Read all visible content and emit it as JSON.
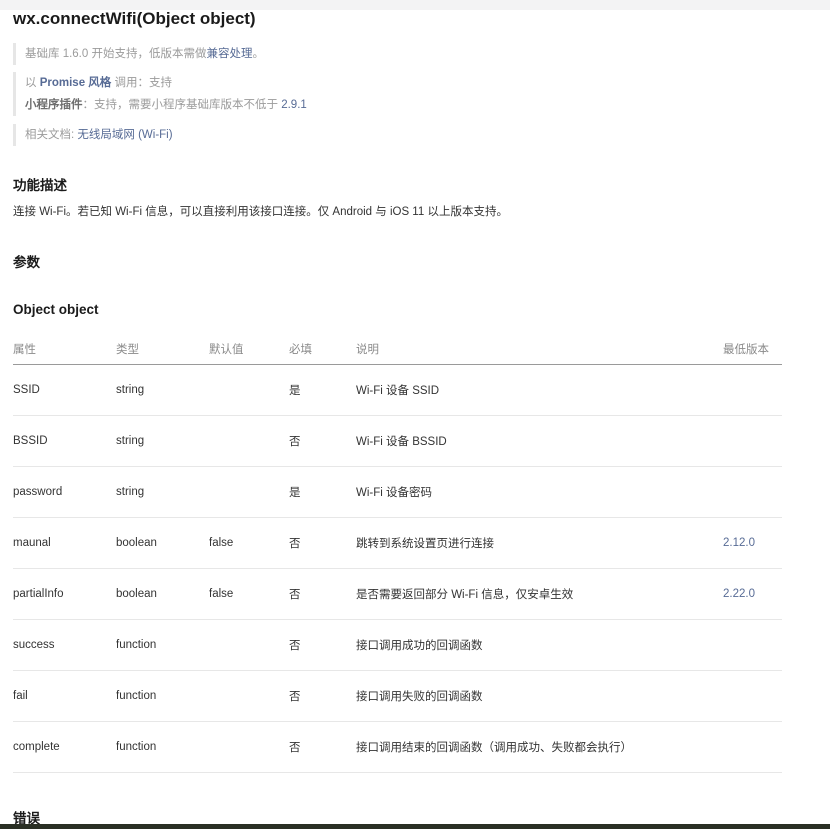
{
  "title": "wx.connectWifi(Object object)",
  "support": {
    "base_text_1": "基础库 1.6.0 开始支持，低版本需做",
    "base_link": "兼容处理",
    "base_text_2": "。",
    "promise_prefix": "以 ",
    "promise_link": "Promise 风格",
    "promise_suffix": " 调用：支持",
    "plugin_label": "小程序插件",
    "plugin_text": "：支持，需要小程序基础库版本不低于 ",
    "plugin_version": "2.9.1",
    "doc_label": "相关文档: ",
    "doc_link": "无线局域网 (Wi-Fi)"
  },
  "sections": {
    "feature": "功能描述",
    "feature_desc": "连接 Wi-Fi。若已知 Wi-Fi 信息，可以直接利用该接口连接。仅 Android 与 iOS 11 以上版本支持。",
    "params": "参数",
    "object": "Object object",
    "errors": "错误"
  },
  "table": {
    "headers": [
      "属性",
      "类型",
      "默认值",
      "必填",
      "说明",
      "最低版本"
    ],
    "rows": [
      {
        "name": "SSID",
        "type": "string",
        "default": "",
        "required": "是",
        "desc": "Wi-Fi 设备 SSID",
        "version": ""
      },
      {
        "name": "BSSID",
        "type": "string",
        "default": "",
        "required": "否",
        "desc": "Wi-Fi 设备 BSSID",
        "version": ""
      },
      {
        "name": "password",
        "type": "string",
        "default": "",
        "required": "是",
        "desc": "Wi-Fi 设备密码",
        "version": ""
      },
      {
        "name": "maunal",
        "type": "boolean",
        "default": "false",
        "required": "否",
        "desc": "跳转到系统设置页进行连接",
        "version": "2.12.0"
      },
      {
        "name": "partialInfo",
        "type": "boolean",
        "default": "false",
        "required": "否",
        "desc": "是否需要返回部分 Wi-Fi 信息，仅安卓生效",
        "version": "2.22.0"
      },
      {
        "name": "success",
        "type": "function",
        "default": "",
        "required": "否",
        "desc": "接口调用成功的回调函数",
        "version": ""
      },
      {
        "name": "fail",
        "type": "function",
        "default": "",
        "required": "否",
        "desc": "接口调用失败的回调函数",
        "version": ""
      },
      {
        "name": "complete",
        "type": "function",
        "default": "",
        "required": "否",
        "desc": "接口调用结束的回调函数（调用成功、失败都会执行）",
        "version": ""
      }
    ]
  },
  "colors": {
    "link": "#576b95",
    "muted": "#9b9b9b",
    "text": "#333333"
  }
}
